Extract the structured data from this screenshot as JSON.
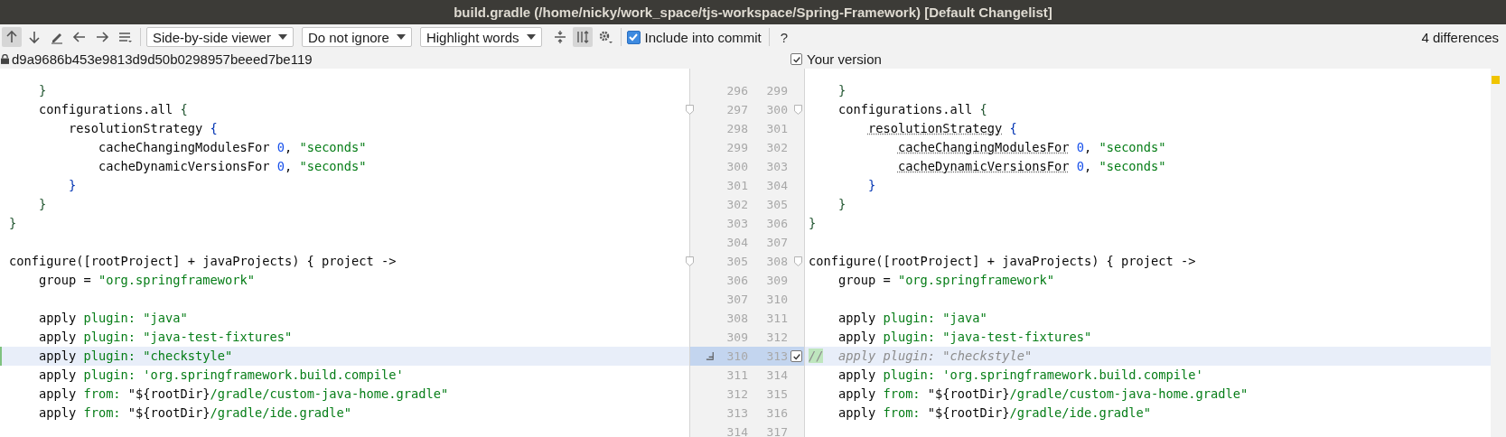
{
  "window": {
    "title": "build.gradle (/home/nicky/work_space/tjs-workspace/Spring-Framework) [Default Changelist]"
  },
  "toolbar": {
    "left_icons": [
      {
        "kind": "up",
        "on": true
      },
      {
        "kind": "down",
        "on": false
      },
      {
        "kind": "edit",
        "on": false
      },
      {
        "kind": "prev",
        "on": false
      },
      {
        "kind": "next",
        "on": false
      },
      {
        "kind": "list",
        "on": false
      }
    ],
    "dropdowns": [
      {
        "label": "Side-by-side viewer"
      },
      {
        "label": "Do not ignore"
      },
      {
        "label": "Highlight words"
      }
    ],
    "right_icons": [
      {
        "kind": "collapse",
        "on": false
      },
      {
        "kind": "sync",
        "on": true
      },
      {
        "kind": "gear",
        "on": false
      }
    ],
    "include": {
      "label": "Include into commit",
      "checked": true
    },
    "help": "?",
    "differences": "4 differences"
  },
  "left_header": {
    "revision": "d9a9686b453e9813d9d50b0298957beeed7be119"
  },
  "right_header": {
    "label": "Your version",
    "checked": true
  },
  "rows": [
    {
      "left_num": "296",
      "right_num": "299",
      "selected": false,
      "left": [
        {
          "text": "    }",
          "kind": "brace"
        }
      ],
      "right": [
        {
          "text": "    }",
          "kind": "brace"
        }
      ]
    },
    {
      "left_num": "297",
      "right_num": "300",
      "selected": false,
      "fold": true,
      "left": [
        {
          "text": "    configurations.all ",
          "kind": "plain"
        },
        {
          "text": "{",
          "kind": "brace"
        }
      ],
      "right": [
        {
          "text": "    configurations.all ",
          "kind": "plain"
        },
        {
          "text": "{",
          "kind": "brace"
        }
      ]
    },
    {
      "left_num": "298",
      "right_num": "301",
      "selected": false,
      "left": [
        {
          "text": "        resolutionStrategy ",
          "kind": "plain"
        },
        {
          "text": "{",
          "kind": "brace2"
        }
      ],
      "right": [
        {
          "text": "        resolutionStrategy",
          "kind": "ref"
        },
        {
          "text": " {",
          "kind": "brace2"
        }
      ]
    },
    {
      "left_num": "299",
      "right_num": "302",
      "selected": false,
      "left": [
        {
          "text": "            cacheChangingModulesFor ",
          "kind": "plain"
        },
        {
          "text": "0",
          "kind": "num"
        },
        {
          "text": ", ",
          "kind": "plain"
        },
        {
          "text": "\"seconds\"",
          "kind": "str"
        }
      ],
      "right": [
        {
          "text": "            cacheChangingModulesFor",
          "kind": "ref"
        },
        {
          "text": " 0",
          "kind": "num"
        },
        {
          "text": ", ",
          "kind": "plain"
        },
        {
          "text": "\"seconds\"",
          "kind": "str"
        }
      ]
    },
    {
      "left_num": "300",
      "right_num": "303",
      "selected": false,
      "left": [
        {
          "text": "            cacheDynamicVersionsFor ",
          "kind": "plain"
        },
        {
          "text": "0",
          "kind": "num"
        },
        {
          "text": ", ",
          "kind": "plain"
        },
        {
          "text": "\"seconds\"",
          "kind": "str"
        }
      ],
      "right": [
        {
          "text": "            cacheDynamicVersionsFor",
          "kind": "ref"
        },
        {
          "text": " 0",
          "kind": "num"
        },
        {
          "text": ", ",
          "kind": "plain"
        },
        {
          "text": "\"seconds\"",
          "kind": "str"
        }
      ]
    },
    {
      "left_num": "301",
      "right_num": "304",
      "selected": false,
      "left": [
        {
          "text": "        }",
          "kind": "brace2"
        }
      ],
      "right": [
        {
          "text": "        }",
          "kind": "brace2"
        }
      ]
    },
    {
      "left_num": "302",
      "right_num": "305",
      "selected": false,
      "left": [
        {
          "text": "    }",
          "kind": "brace"
        }
      ],
      "right": [
        {
          "text": "    }",
          "kind": "brace"
        }
      ]
    },
    {
      "left_num": "303",
      "right_num": "306",
      "selected": false,
      "left": [
        {
          "text": "}",
          "kind": "brace"
        }
      ],
      "right": [
        {
          "text": "}",
          "kind": "brace"
        }
      ]
    },
    {
      "left_num": "304",
      "right_num": "307",
      "selected": false
    },
    {
      "left_num": "305",
      "right_num": "308",
      "selected": false,
      "fold": true,
      "left": [
        {
          "text": "configure([rootProject] + javaProjects) { project ->",
          "kind": "plain"
        }
      ],
      "right": [
        {
          "text": "configure([rootProject] + javaProjects) { project ->",
          "kind": "plain"
        }
      ]
    },
    {
      "left_num": "306",
      "right_num": "309",
      "selected": false,
      "left": [
        {
          "text": "    group = ",
          "kind": "plain"
        },
        {
          "text": "\"org.springframework\"",
          "kind": "str"
        }
      ],
      "right": [
        {
          "text": "    group = ",
          "kind": "plain"
        },
        {
          "text": "\"org.springframework\"",
          "kind": "str"
        }
      ]
    },
    {
      "left_num": "307",
      "right_num": "310",
      "selected": false
    },
    {
      "left_num": "308",
      "right_num": "311",
      "selected": false,
      "left": [
        {
          "text": "    apply ",
          "kind": "plain"
        },
        {
          "text": "plugin:",
          "kind": "kw"
        },
        {
          "text": " \"java\"",
          "kind": "str"
        }
      ],
      "right": [
        {
          "text": "    apply ",
          "kind": "plain"
        },
        {
          "text": "plugin:",
          "kind": "kw"
        },
        {
          "text": " \"java\"",
          "kind": "str"
        }
      ]
    },
    {
      "left_num": "309",
      "right_num": "312",
      "selected": false,
      "left": [
        {
          "text": "    apply ",
          "kind": "plain"
        },
        {
          "text": "plugin:",
          "kind": "kw"
        },
        {
          "text": " \"java-test-fixtures\"",
          "kind": "str"
        }
      ],
      "right": [
        {
          "text": "    apply ",
          "kind": "plain"
        },
        {
          "text": "plugin:",
          "kind": "kw"
        },
        {
          "text": " \"java-test-fixtures\"",
          "kind": "str"
        }
      ]
    },
    {
      "left_num": "310",
      "right_num": "313",
      "selected": true,
      "changed": true,
      "checked": true,
      "left": [
        {
          "text": "    apply ",
          "kind": "plain"
        },
        {
          "text": "plugin:",
          "kind": "kw"
        },
        {
          "text": " \"checkstyle\"",
          "kind": "str"
        }
      ],
      "right": [
        {
          "text": "//",
          "kind": "mark"
        },
        {
          "text": "  apply plugin: \"checkstyle\"",
          "kind": "comment"
        }
      ]
    },
    {
      "left_num": "311",
      "right_num": "314",
      "selected": false,
      "left": [
        {
          "text": "    apply ",
          "kind": "plain"
        },
        {
          "text": "plugin:",
          "kind": "kw"
        },
        {
          "text": " 'org.springframework.build.compile'",
          "kind": "str"
        }
      ],
      "right": [
        {
          "text": "    apply ",
          "kind": "plain"
        },
        {
          "text": "plugin:",
          "kind": "kw"
        },
        {
          "text": " 'org.springframework.build.compile'",
          "kind": "str"
        }
      ]
    },
    {
      "left_num": "312",
      "right_num": "315",
      "selected": false,
      "left": [
        {
          "text": "    apply ",
          "kind": "plain"
        },
        {
          "text": "from:",
          "kind": "kw"
        },
        {
          "text": " \"${rootDir}",
          "kind": "plain"
        },
        {
          "text": "/gradle/custom-java-home.gradle\"",
          "kind": "str"
        }
      ],
      "right": [
        {
          "text": "    apply ",
          "kind": "plain"
        },
        {
          "text": "from:",
          "kind": "kw"
        },
        {
          "text": " \"${rootDir}",
          "kind": "plain"
        },
        {
          "text": "/gradle/custom-java-home.gradle\"",
          "kind": "str"
        }
      ]
    },
    {
      "left_num": "313",
      "right_num": "316",
      "selected": false,
      "left": [
        {
          "text": "    apply ",
          "kind": "plain"
        },
        {
          "text": "from:",
          "kind": "kw"
        },
        {
          "text": " \"${rootDir}",
          "kind": "plain"
        },
        {
          "text": "/gradle/ide.gradle\"",
          "kind": "str"
        }
      ],
      "right": [
        {
          "text": "    apply ",
          "kind": "plain"
        },
        {
          "text": "from:",
          "kind": "kw"
        },
        {
          "text": " \"${rootDir}",
          "kind": "plain"
        },
        {
          "text": "/gradle/ide.gradle\"",
          "kind": "str"
        }
      ]
    },
    {
      "left_num": "314",
      "right_num": "317",
      "selected": false
    }
  ]
}
